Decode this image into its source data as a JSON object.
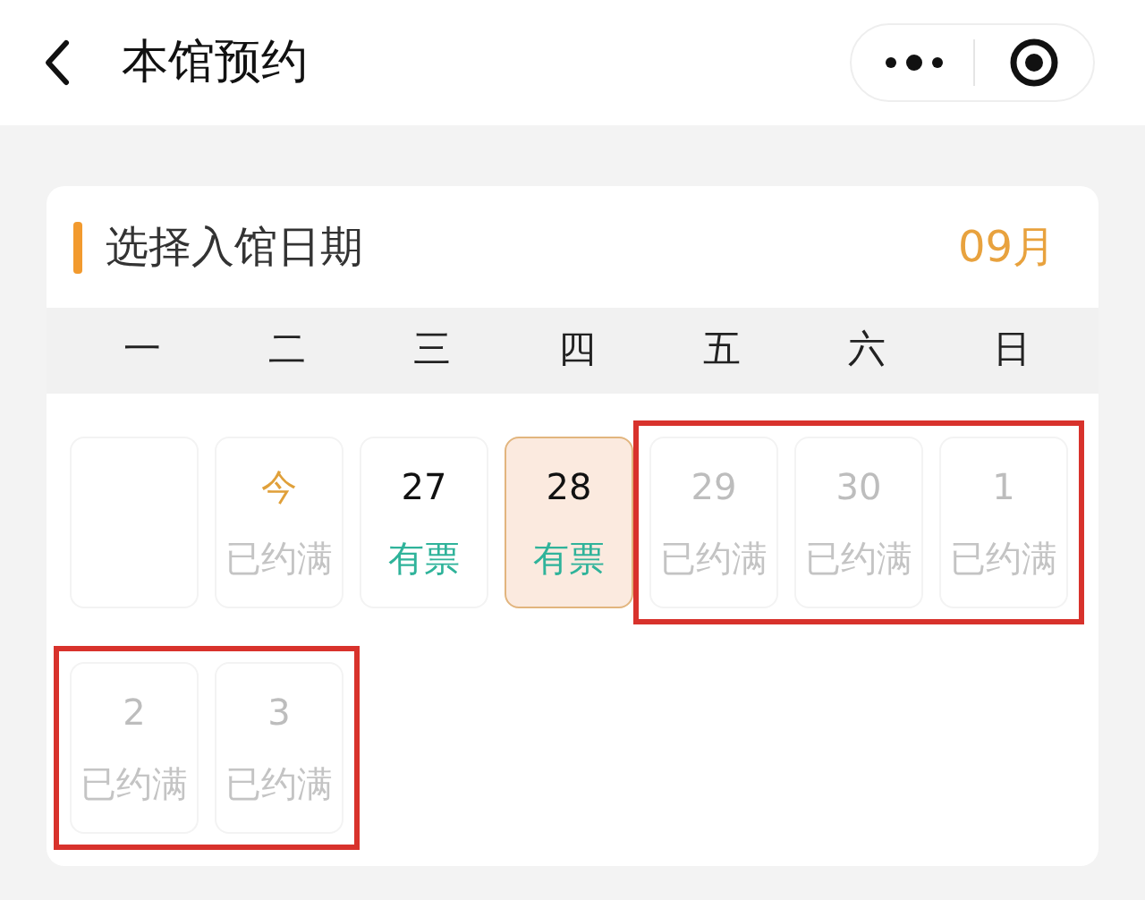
{
  "header": {
    "title": "本馆预约"
  },
  "card": {
    "title": "选择入馆日期",
    "month": "09月"
  },
  "weekdays": [
    "一",
    "二",
    "三",
    "四",
    "五",
    "六",
    "日"
  ],
  "weeks": [
    {
      "days": [
        {
          "kind": "empty",
          "selected": false
        },
        {
          "kind": "today",
          "number": "今",
          "status": "已约满",
          "selected": false
        },
        {
          "kind": "available",
          "number": "27",
          "status": "有票",
          "selected": false
        },
        {
          "kind": "available",
          "number": "28",
          "status": "有票",
          "selected": true
        },
        {
          "kind": "full",
          "number": "29",
          "status": "已约满",
          "selected": false,
          "marked": true
        },
        {
          "kind": "full",
          "number": "30",
          "status": "已约满",
          "selected": false,
          "marked": true
        },
        {
          "kind": "full",
          "number": "1",
          "status": "已约满",
          "selected": false,
          "marked": true
        }
      ]
    },
    {
      "days": [
        {
          "kind": "full",
          "number": "2",
          "status": "已约满",
          "selected": false,
          "marked": true
        },
        {
          "kind": "full",
          "number": "3",
          "status": "已约满",
          "selected": false,
          "marked": true
        }
      ]
    }
  ]
}
